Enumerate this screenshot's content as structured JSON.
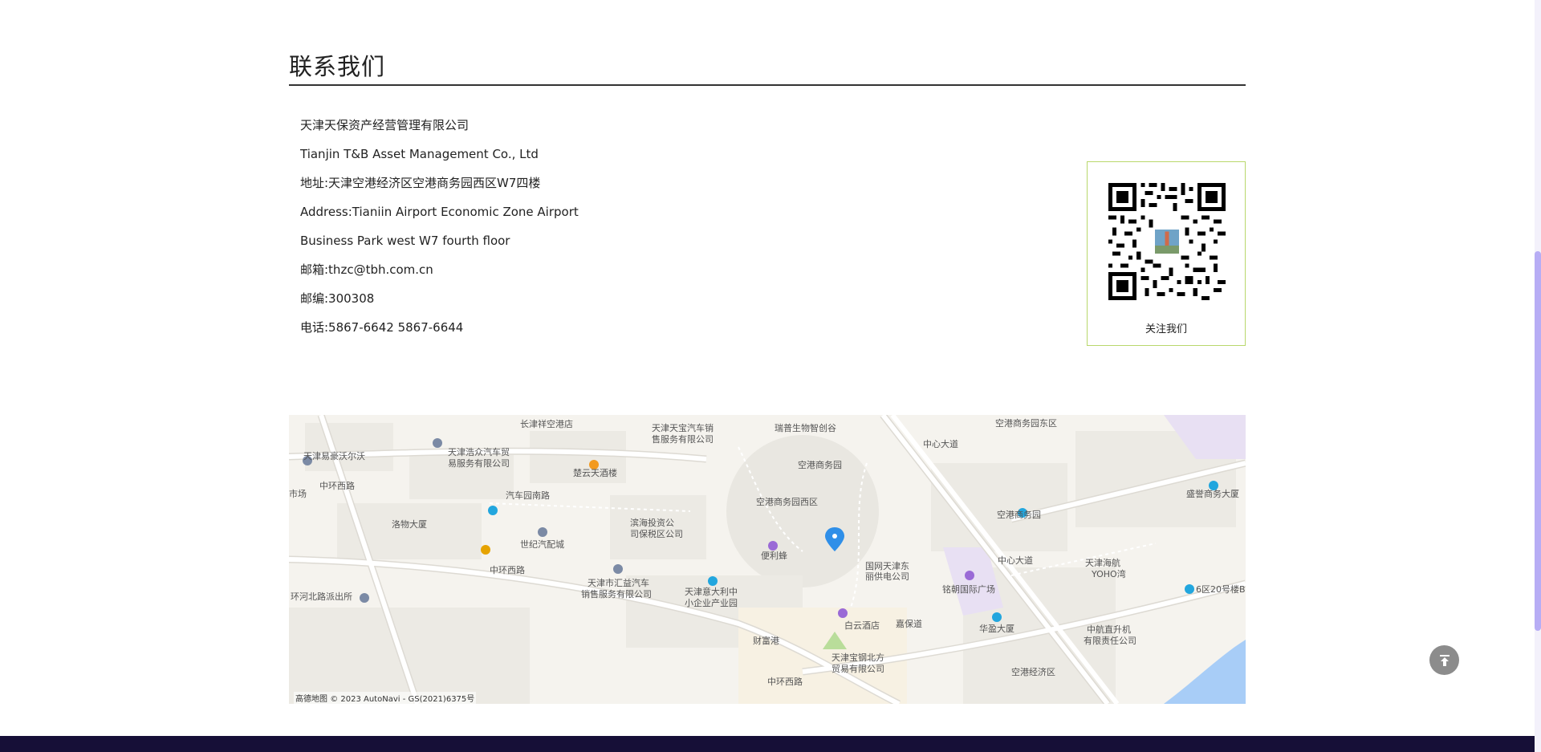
{
  "section": {
    "title": "联系我们"
  },
  "contact": {
    "lines": [
      "天津天保资产经营管理有限公司",
      "Tianjin T&B Asset Management Co., Ltd",
      "地址:天津空港经济区空港商务园西区W7四楼",
      "Address:Tianiin Airport Economic Zone Airport",
      "Business Park west W7 fourth floor",
      "邮箱:thzc@tbh.com.cn",
      "邮编:300308",
      "电话:5867-6642 5867-6644"
    ]
  },
  "qr": {
    "caption": "关注我们"
  },
  "map": {
    "labels": [
      "长津祥空港店",
      "天津天宝汽车销",
      "售服务有限公司",
      "瑞普生物智创谷",
      "空港商务园东区",
      "天津浩众汽车贸",
      "易服务有限公司",
      "天津易豪沃尔沃",
      "楚云天酒楼",
      "空港商务园",
      "盛誉商务大厦",
      "市场",
      "汽车园南路",
      "空港商务园西区",
      "空港商务园",
      "洛物大厦",
      "滨海投资公",
      "司保税区公司",
      "世纪汽配城",
      "便利蜂",
      "中环西路",
      "天津市汇益汽车",
      "销售服务有限公司",
      "国网天津东",
      "丽供电公司",
      "铭朝国际广场",
      "天津海航",
      "YOHO湾",
      "6区20号楼B",
      "环河北路派出所",
      "天津意大利中",
      "小企业产业园",
      "白云酒店",
      "嘉保道",
      "华盈大厦",
      "中航直升机",
      "有限责任公司",
      "财富港",
      "天津宝钢北方",
      "贸易有限公司",
      "空港经济区",
      "中环西路",
      "中心大道",
      "中心大道",
      "中环西路"
    ],
    "attribution": "© 2023 AutoNavi - GS(2021)6375号",
    "logo_text": "高德地图",
    "colors": {
      "land": "#f5f3ee",
      "block": "#eceae4",
      "road": "#ffffff",
      "road_edge": "#dddad3",
      "water": "#a8cdf7",
      "purple_zone": "#e8e0f3",
      "green": "#b9dd9a",
      "marker": "#2f8fe8"
    }
  },
  "back_to_top": {
    "icon": "arrow-up-to-line-icon"
  }
}
